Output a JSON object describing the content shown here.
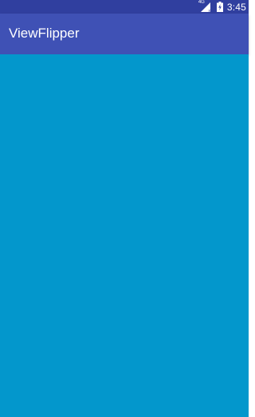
{
  "status_bar": {
    "network_type": "4G",
    "signal_icon": "signal-no-data-icon",
    "battery_icon": "battery-charging-icon",
    "time": "3:45"
  },
  "toolbar": {
    "title": "ViewFlipper"
  },
  "colors": {
    "status_bar": "#303F9F",
    "toolbar": "#3F51B5",
    "content_background": "#0397CC"
  }
}
